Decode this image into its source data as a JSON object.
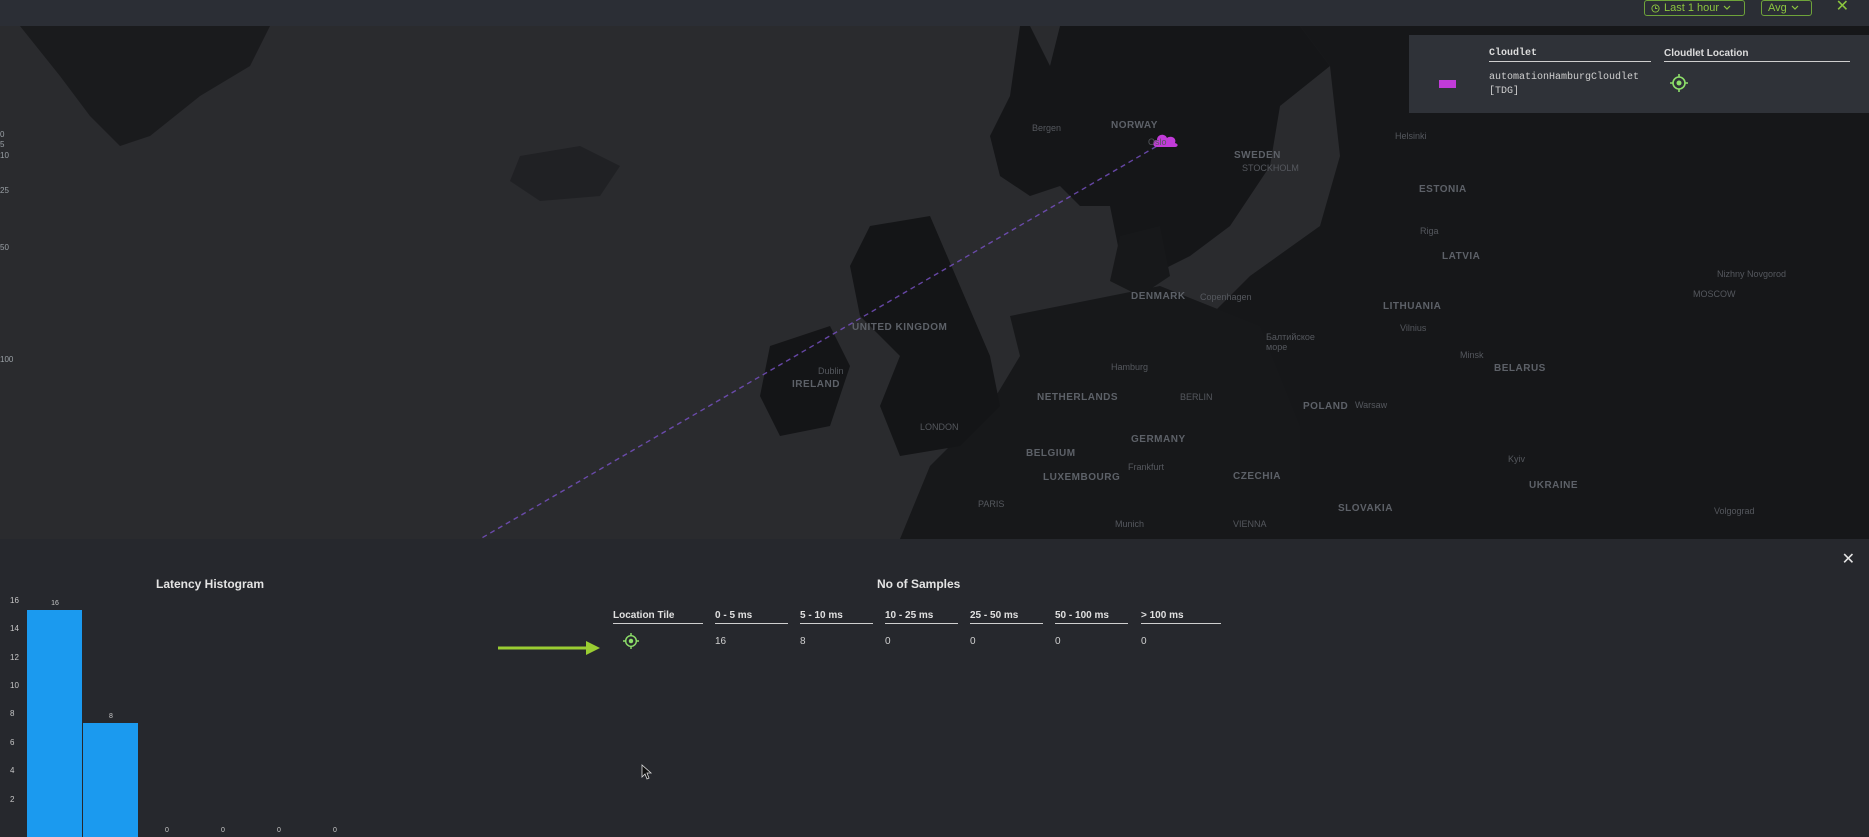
{
  "toolbar": {
    "time_range_label": "Last 1 hour",
    "aggregate_label": "Avg"
  },
  "map": {
    "countries": [
      "NORWAY",
      "SWEDEN",
      "ESTONIA",
      "LATVIA",
      "LITHUANIA",
      "BELARUS",
      "DENMARK",
      "UNITED KINGDOM",
      "IRELAND",
      "NETHERLANDS",
      "GERMANY",
      "POLAND",
      "BELGIUM",
      "LUXEMBOURG",
      "CZECHIA",
      "SLOVAKIA",
      "UKRAINE"
    ],
    "cities": [
      "STOCKHOLM",
      "LONDON",
      "BERLIN",
      "MOSCOW",
      "PARIS",
      "Dublin",
      "Copenhagen",
      "Hamburg",
      "Frankfurt",
      "Munich",
      "VIENNA",
      "Warsaw",
      "Vilnius",
      "Minsk",
      "Kyiv",
      "Helsinki",
      "Oslo",
      "Bergen",
      "Riga",
      "Nizhny Novgorod",
      "Volgograd"
    ],
    "sea_label": "Балтийское море",
    "left_axis_ticks": [
      "0",
      "5",
      "10",
      "25",
      "50",
      "100"
    ]
  },
  "legend": {
    "col_cloudlet": "Cloudlet",
    "col_location": "Cloudlet Location",
    "cloudlet_name": "automationHamburgCloudlet",
    "cloudlet_org": "[TDG]",
    "swatch_color": "#c13bd8"
  },
  "panel": {
    "histogram_title": "Latency Histogram",
    "samples_title": "No of Samples",
    "table_headers": [
      "Location Tile",
      "0 - 5 ms",
      "5 - 10 ms",
      "10 - 25 ms",
      "25 - 50 ms",
      "50 - 100 ms",
      "> 100 ms"
    ],
    "table_row": [
      "16",
      "8",
      "0",
      "0",
      "0",
      "0"
    ]
  },
  "chart_data": {
    "type": "bar",
    "title": "Latency Histogram",
    "categories": [
      "0 - 5 ms",
      "5 - 10 ms",
      "10 - 25 ms",
      "25 - 50 ms",
      "50 - 100 ms",
      "> 100 ms"
    ],
    "values": [
      16,
      8,
      0,
      0,
      0,
      0
    ],
    "y_ticks": [
      2,
      4,
      6,
      8,
      10,
      12,
      14,
      16
    ],
    "bar_color": "#1b9aef"
  }
}
